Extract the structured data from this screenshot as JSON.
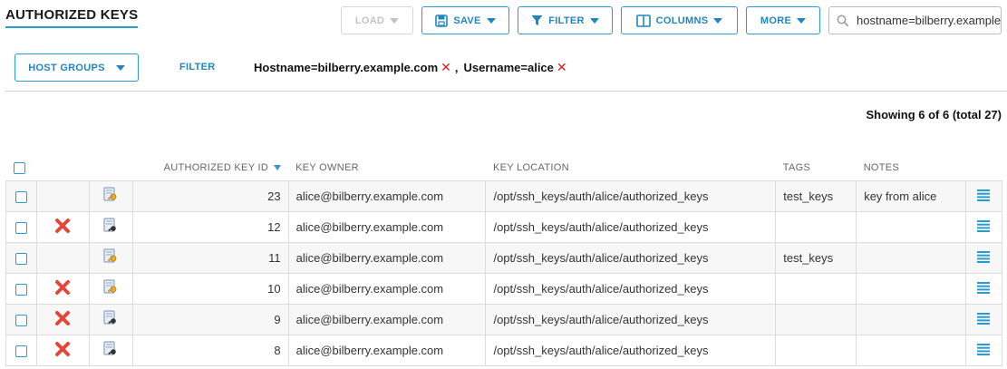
{
  "page": {
    "title": "AUTHORIZED KEYS"
  },
  "toolbar": {
    "load_label": "LOAD",
    "save_label": "SAVE",
    "filter_label": "FILTER",
    "columns_label": "COLUMNS",
    "more_label": "MORE",
    "search_value": "hostname=bilberry.example.com"
  },
  "filterbar": {
    "host_groups_label": "HOST GROUPS",
    "filter_label": "FILTER",
    "chips": [
      {
        "label": "Hostname=bilberry.example.com"
      },
      {
        "label": "Username=alice"
      }
    ],
    "separator": ","
  },
  "summary": {
    "showing": "Showing 6 of 6 (total 27)"
  },
  "table": {
    "columns": {
      "id": "AUTHORIZED KEY ID",
      "owner": "KEY OWNER",
      "location": "KEY LOCATION",
      "tags": "TAGS",
      "notes": "NOTES"
    },
    "rows": [
      {
        "id": "23",
        "owner": "alice@bilberry.example.com",
        "location": "/opt/ssh_keys/auth/alice/authorized_keys",
        "tags": "test_keys",
        "notes": "key from alice",
        "deleted": false,
        "key_icon": "key-gold"
      },
      {
        "id": "12",
        "owner": "alice@bilberry.example.com",
        "location": "/opt/ssh_keys/auth/alice/authorized_keys",
        "tags": "",
        "notes": "",
        "deleted": true,
        "key_icon": "key-dark"
      },
      {
        "id": "11",
        "owner": "alice@bilberry.example.com",
        "location": "/opt/ssh_keys/auth/alice/authorized_keys",
        "tags": "test_keys",
        "notes": "",
        "deleted": false,
        "key_icon": "key-gold"
      },
      {
        "id": "10",
        "owner": "alice@bilberry.example.com",
        "location": "/opt/ssh_keys/auth/alice/authorized_keys",
        "tags": "",
        "notes": "",
        "deleted": true,
        "key_icon": "key-gold"
      },
      {
        "id": "9",
        "owner": "alice@bilberry.example.com",
        "location": "/opt/ssh_keys/auth/alice/authorized_keys",
        "tags": "",
        "notes": "",
        "deleted": true,
        "key_icon": "key-dark"
      },
      {
        "id": "8",
        "owner": "alice@bilberry.example.com",
        "location": "/opt/ssh_keys/auth/alice/authorized_keys",
        "tags": "",
        "notes": "",
        "deleted": true,
        "key_icon": "key-dark"
      }
    ]
  },
  "colors": {
    "accent": "#2a9bd0",
    "delete": "#e2483a"
  }
}
